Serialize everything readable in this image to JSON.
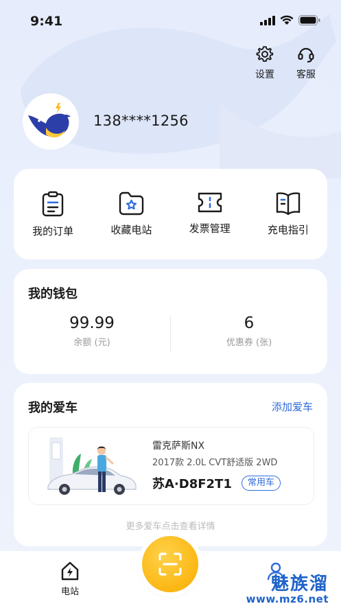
{
  "status_bar": {
    "time": "9:41"
  },
  "top_actions": {
    "settings_label": "设置",
    "service_label": "客服"
  },
  "profile": {
    "phone": "138****1256"
  },
  "quick_menu": [
    {
      "label": "我的订单",
      "icon": "clipboard-list-icon"
    },
    {
      "label": "收藏电站",
      "icon": "folder-star-icon"
    },
    {
      "label": "发票管理",
      "icon": "ticket-icon"
    },
    {
      "label": "充电指引",
      "icon": "book-guide-icon"
    }
  ],
  "wallet": {
    "title": "我的钱包",
    "balance_value": "99.99",
    "balance_label": "余额 (元)",
    "coupon_value": "6",
    "coupon_label": "优惠券 (张)"
  },
  "cars": {
    "title": "我的爱车",
    "add_label": "添加爱车",
    "car": {
      "name": "雷克萨斯NX",
      "spec": "2017款 2.0L CVT舒适版 2WD",
      "plate": "苏A·D8F2T1",
      "badge": "常用车"
    },
    "more_tip": "更多爱车点击查看详情"
  },
  "tabbar": {
    "station_label": "电站"
  },
  "watermark": {
    "title": "魅族溜",
    "title_small": "我",
    "url": "www.mz6.net"
  },
  "colors": {
    "accent": "#2f6bdb",
    "scan_button": "#fbb714",
    "background": "#e9eefb"
  }
}
